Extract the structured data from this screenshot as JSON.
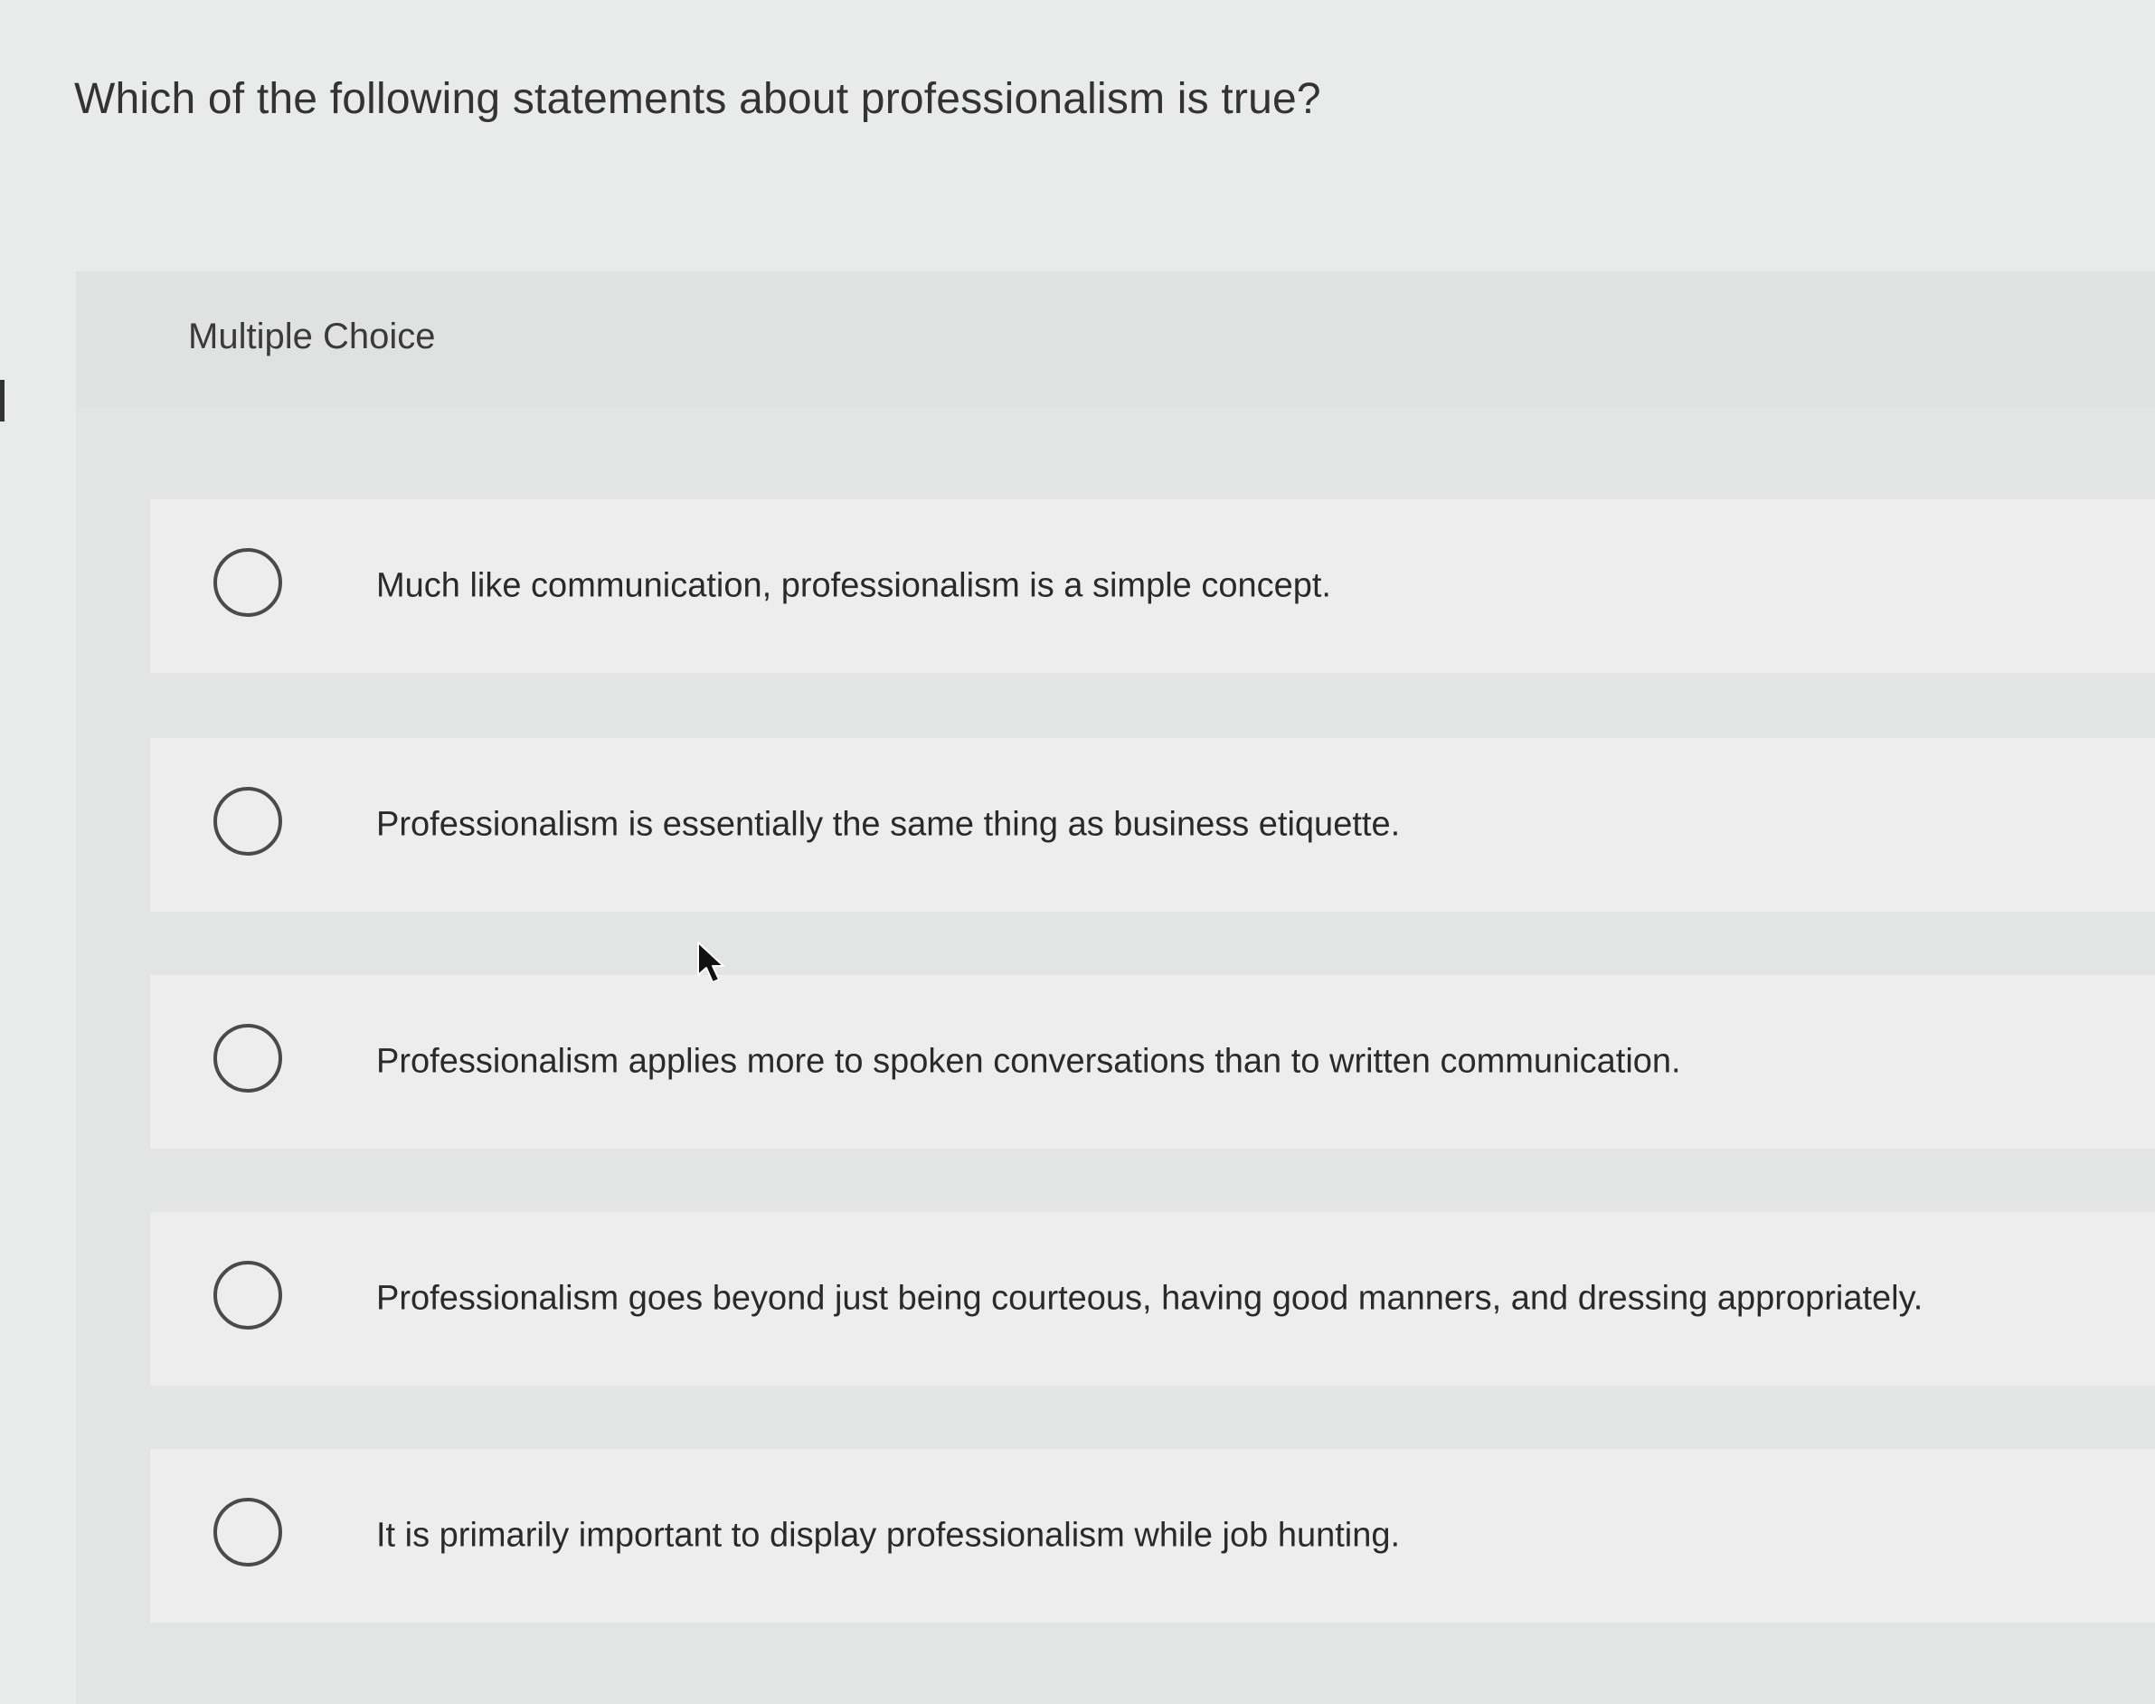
{
  "question": {
    "text": "Which of the following statements about professionalism is true?"
  },
  "answer_panel": {
    "type_label": "Multiple Choice",
    "options": [
      {
        "label": "Much like communication, professionalism is a simple concept."
      },
      {
        "label": "Professionalism is essentially the same thing as business etiquette."
      },
      {
        "label": "Professionalism applies more to spoken conversations than to written communication."
      },
      {
        "label": "Professionalism goes beyond just being courteous, having good manners, and dressing appropriately."
      },
      {
        "label": "It is primarily important to display professionalism while job hunting."
      }
    ]
  },
  "icons": {
    "radio": "radio-unselected-icon",
    "cursor": "mouse-pointer-icon"
  }
}
